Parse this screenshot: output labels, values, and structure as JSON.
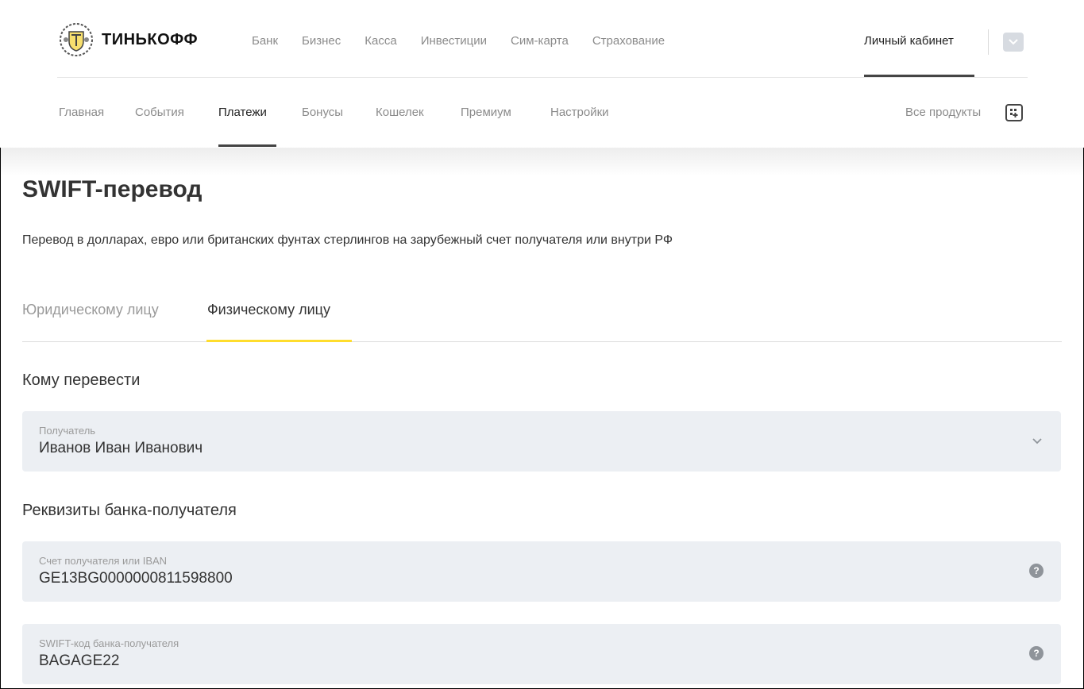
{
  "header": {
    "logo_text": "ТИНЬКОФФ",
    "top_menu": [
      "Банк",
      "Бизнес",
      "Касса",
      "Инвестиции",
      "Сим-карта",
      "Страхование"
    ],
    "cabinet_label": "Личный кабинет",
    "sub_menu": [
      "Главная",
      "События",
      "Платежи",
      "Бонусы",
      "Кошелек",
      "Премиум",
      "Настройки"
    ],
    "sub_menu_active": "Платежи",
    "all_products_label": "Все продукты"
  },
  "page": {
    "title": "SWIFT-перевод",
    "description": "Перевод в долларах, евро или британских фунтах стерлингов на зарубежный счет получателя или внутри РФ",
    "tabs": [
      {
        "label": "Юридическому лицу",
        "active": false
      },
      {
        "label": "Физическому лицу",
        "active": true
      }
    ]
  },
  "form": {
    "section_recipient": "Кому перевести",
    "recipient": {
      "label": "Получатель",
      "value": "Иванов Иван Иванович"
    },
    "section_bank": "Реквизиты банка-получателя",
    "account": {
      "label": "Счет получателя или IBAN",
      "value": "GE13BG0000000811598800"
    },
    "swift": {
      "label": "SWIFT-код банка-получателя",
      "value": "BAGAGE22"
    }
  },
  "colors": {
    "accent_tab_underline": "#ffdd2d",
    "field_background": "#eceff3",
    "muted_text": "#8b8b8b"
  },
  "icons": [
    "tinkoff-emblem-icon",
    "chevron-down-icon",
    "add-products-icon",
    "help-icon"
  ]
}
